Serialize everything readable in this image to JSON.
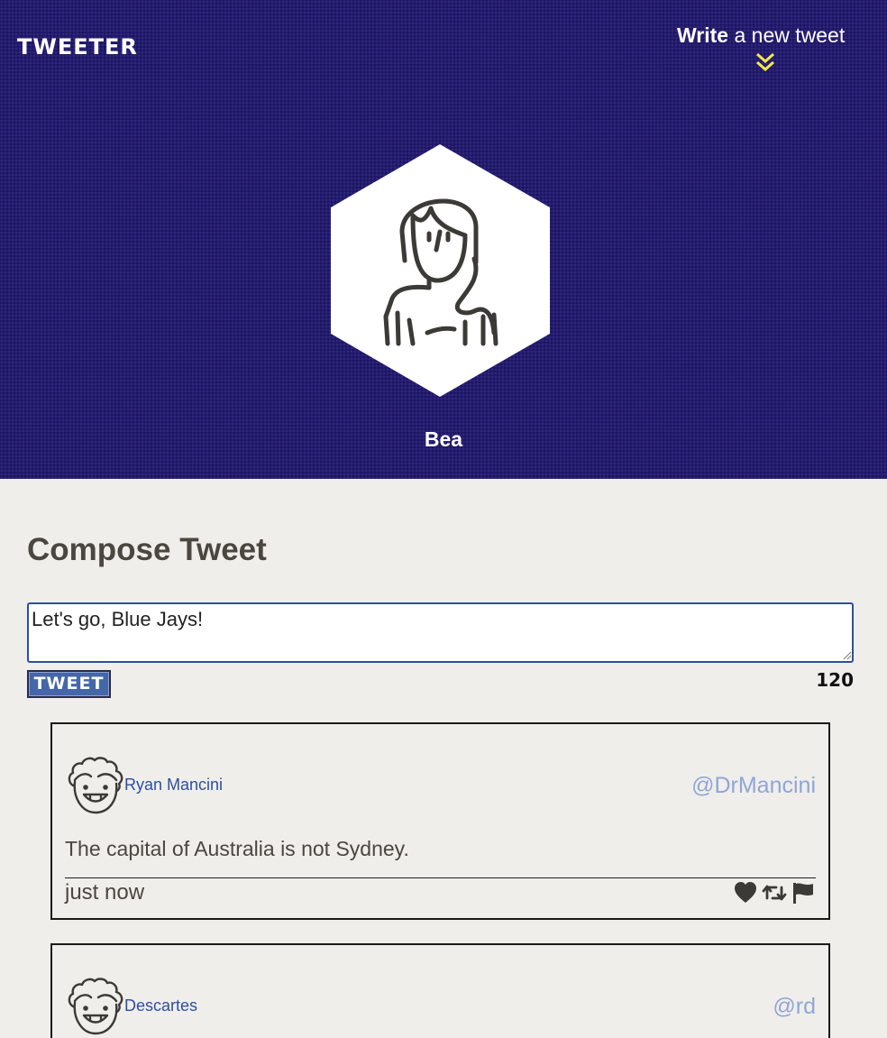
{
  "header": {
    "logo": "TWEETER",
    "write_bold": "Write",
    "write_rest": " a new tweet",
    "profile_name": "Bea"
  },
  "compose": {
    "title": "Compose Tweet",
    "input_value": "Let's go, Blue Jays!",
    "button_label": "TWEET",
    "counter": "120"
  },
  "tweets": [
    {
      "name": "Ryan Mancini",
      "handle": "@DrMancini",
      "text": "The capital of Australia is not Sydney.",
      "time": "just now",
      "actions": [
        "heart-icon",
        "retweet-icon",
        "flag-icon"
      ]
    },
    {
      "name": "Descartes",
      "handle": "@rd"
    }
  ],
  "colors": {
    "header_bg": "#231b70",
    "page_bg": "#f0eeeb",
    "accent": "#4566a8",
    "chevron": "#f2e84b",
    "handle": "#8fa6d8"
  }
}
